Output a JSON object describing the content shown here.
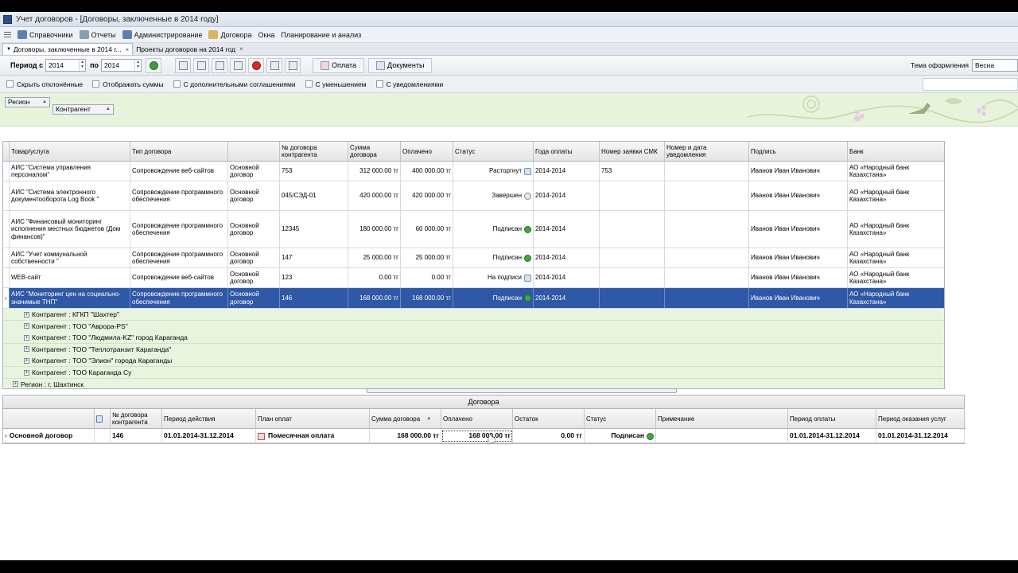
{
  "window": {
    "title": "Учет договоров - [Договоры, заключенные в 2014 году]"
  },
  "menu": [
    {
      "label": "Справочники",
      "icon": "book-icon",
      "color": "#5b7fb5"
    },
    {
      "label": "Отчеты",
      "icon": "report-icon",
      "color": "#8c9bb0"
    },
    {
      "label": "Администрирование",
      "icon": "admin-icon",
      "color": "#5b7fb5"
    },
    {
      "label": "Договора",
      "icon": "contract-icon",
      "color": "#d8b45a"
    },
    {
      "label": "Окна",
      "icon": "",
      "color": ""
    },
    {
      "label": "Планирование и анализ",
      "icon": "",
      "color": ""
    }
  ],
  "doc_tabs": [
    {
      "label": "Договоры, заключенные в 2014 г...",
      "close": "×"
    },
    {
      "label": "Проекты договоров на 2014 год",
      "close": "×"
    }
  ],
  "toolbar": {
    "period_from_label": "Период с",
    "period_from_value": "2014",
    "period_to_label": "по",
    "period_to_value": "2014",
    "payment_button": "Оплата",
    "documents_button": "Документы",
    "theme_label": "Тема оформления",
    "theme_value": "Весна"
  },
  "filters": [
    "Скрыть отклонённые",
    "Отображать суммы",
    "С дополнительными соглашениями",
    "С уменьшением",
    "С уведомлениями"
  ],
  "grouping": {
    "level1": "Регион",
    "level2": "Контрагент"
  },
  "grid": {
    "columns": [
      "Товар/услуга",
      "Тип договора",
      "",
      "№ договора контрагента",
      "Сумма договора",
      "Оплачено",
      "Статус",
      "Года оплаты",
      "Номер заявки СМК",
      "Номер и дата уведомления",
      "Подпись",
      "Банк"
    ],
    "rows": [
      {
        "product": "АИС \"Система управления персоналом\"",
        "type": "Сопровождение веб-сайтов",
        "kind": "Основной договор",
        "number": "753",
        "sum": "312 000.00 тг",
        "paid": "400 000.00 тг",
        "status": "Расторгнут",
        "status_icon": "document-icon",
        "years": "2014-2014",
        "smk": "753",
        "notice": "",
        "signer": "Иванов Иван Иванович",
        "bank": "АО «Народный банк Казахстана»"
      },
      {
        "product": "АИС \"Система электронного документооборота Log Book \"",
        "type": "Сопровождение программного обеспечения",
        "kind": "Основной договор",
        "number": "045/СЭД-01",
        "sum": "420 000.00 тг",
        "paid": "420 000.00 тг",
        "status": "Завершен",
        "status_icon": "clock-icon",
        "years": "2014-2014",
        "smk": "",
        "notice": "",
        "signer": "Иванов Иван Иванович",
        "bank": "АО «Народный банк Казахстана»"
      },
      {
        "product": "АИС \"Финансовый мониторинг исполнения местных бюджетов (Дом финансов)\"",
        "type": "Сопровождение программного обеспечения",
        "kind": "Основной договор",
        "number": "12345",
        "sum": "180 000.00 тг",
        "paid": "60 000.00 тг",
        "status": "Подписан",
        "status_icon": "check-icon",
        "years": "2014-2014",
        "smk": "",
        "notice": "",
        "signer": "Иванов Иван Иванович",
        "bank": "АО «Народный банк Казахстана»"
      },
      {
        "product": "АИС \"Учет коммунальной собственности \"",
        "type": "Сопровождение программного обеспечения",
        "kind": "Основной договор",
        "number": "147",
        "sum": "25 000.00 тг",
        "paid": "25 000.00 тг",
        "status": "Подписан",
        "status_icon": "check-icon",
        "years": "2014-2014",
        "smk": "",
        "notice": "",
        "signer": "Иванов Иван Иванович",
        "bank": "АО «Народный банк Казахстана»"
      },
      {
        "product": "WEB-сайт",
        "type": "Сопровождение веб-сайтов",
        "kind": "Основной договор",
        "number": "123",
        "sum": "0.00 тг",
        "paid": "0.00 тг",
        "status": "На подписи",
        "status_icon": "sign-icon",
        "years": "2014-2014",
        "smk": "",
        "notice": "",
        "signer": "Иванов Иван Иванович",
        "bank": "АО «Народный банк Казахстана»"
      },
      {
        "product": "АИС \"Мониторинг цен на социально-значимые ТНП\"",
        "type": "Сопровождение программного обеспечения",
        "kind": "Основной договор",
        "number": "146",
        "sum": "168 000.00 тг",
        "paid": "168 000.00 тг",
        "status": "Подписан",
        "status_icon": "check-icon",
        "years": "2014-2014",
        "smk": "",
        "notice": "",
        "signer": "Иванов Иван Иванович",
        "bank": "АО «Народный банк Казахстана»",
        "selected": true
      }
    ],
    "groups": [
      "Контрагент : КГКП \"Шахтер\"",
      "Контрагент : ТОО \"Аврора-PS\"",
      "Контрагент : ТОО \"Людмила-KZ\" город Караганда",
      "Контрагент : ТОО \"Теплотранзит Караганда\"",
      "Контрагент : ТОО \"Элион\" города Караганды",
      "Контрагент : ТОО Караганда Су",
      "Регион : г. Шахтинск"
    ]
  },
  "bottom": {
    "band_title": "Договора",
    "columns": [
      "",
      "",
      "№ договора контрагента",
      "Период действия",
      "План оплат",
      "Сумма договора",
      "Оплачено",
      "Остаток",
      "Статус",
      "Примечание",
      "Период оплаты",
      "Период оказания услуг"
    ],
    "row": {
      "kind": "Основной договор",
      "number": "146",
      "period": "01.01.2014-31.12.2014",
      "plan": "Помесячная оплата",
      "sum": "168 000.00 тг",
      "paid": "168 000.00 тг",
      "rest": "0.00 тг",
      "status": "Подписан",
      "note": "",
      "pay_period": "01.01.2014-31.12.2014",
      "service_period": "01.01.2014-31.12.2014"
    }
  },
  "colors": {
    "selection": "#2f58a6",
    "group_band": "#e8f3dc",
    "ok_green": "#3ea83a",
    "delete_red": "#d82a2a"
  }
}
